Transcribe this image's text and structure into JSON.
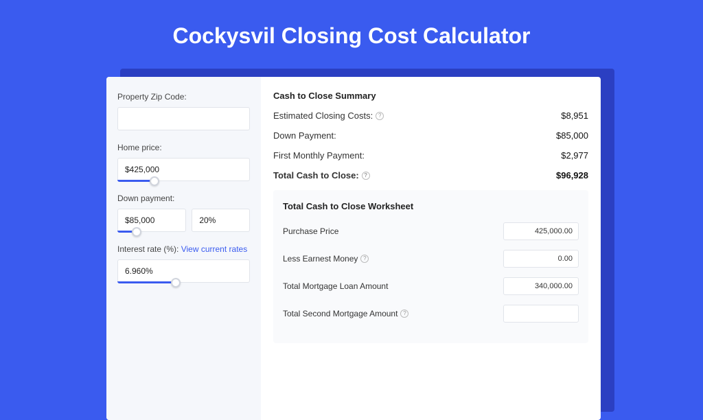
{
  "hero": {
    "title": "Cockysvil Closing Cost Calculator"
  },
  "sidebar": {
    "zip": {
      "label": "Property Zip Code:",
      "value": ""
    },
    "home_price": {
      "label": "Home price:",
      "value": "$425,000"
    },
    "down_payment": {
      "label": "Down payment:",
      "amount": "$85,000",
      "percent": "20%"
    },
    "interest_rate": {
      "label": "Interest rate (%):",
      "link_text": "View current rates",
      "value": "6.960%"
    }
  },
  "summary": {
    "title": "Cash to Close Summary",
    "rows": [
      {
        "label": "Estimated Closing Costs:",
        "value": "$8,951",
        "help": true
      },
      {
        "label": "Down Payment:",
        "value": "$85,000",
        "help": false
      },
      {
        "label": "First Monthly Payment:",
        "value": "$2,977",
        "help": false
      }
    ],
    "total": {
      "label": "Total Cash to Close:",
      "value": "$96,928",
      "help": true
    }
  },
  "worksheet": {
    "title": "Total Cash to Close Worksheet",
    "rows": [
      {
        "label": "Purchase Price",
        "value": "425,000.00",
        "help": false
      },
      {
        "label": "Less Earnest Money",
        "value": "0.00",
        "help": true
      },
      {
        "label": "Total Mortgage Loan Amount",
        "value": "340,000.00",
        "help": false
      },
      {
        "label": "Total Second Mortgage Amount",
        "value": "",
        "help": true
      }
    ]
  }
}
